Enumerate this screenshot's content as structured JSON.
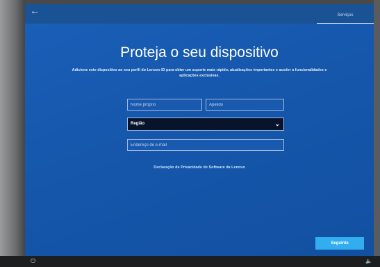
{
  "topbar": {
    "back_icon": "arrow-left-icon",
    "services_tab": "Serviços"
  },
  "main": {
    "title": "Proteja o seu dispositivo",
    "subtitle": "Adicione este dispositivo ao seu perfil do Lenovo ID para obter um suporte mais rápido, atualizações importantes e aceder a funcionalidades e aplicações exclusivas."
  },
  "form": {
    "first_name_placeholder": "Nome próprio",
    "last_name_placeholder": "Apelido",
    "region_label": "Região",
    "email_placeholder": "Endereço de e-mail"
  },
  "privacy_link": "Declaração de Privacidade de Software da Lenovo",
  "next_button": "Seguinte",
  "taskbar": {
    "power_icon": "power-icon",
    "volume_icon": "volume-icon"
  },
  "colors": {
    "screen_blue": "#1658ad",
    "next_button": "#32aef0",
    "region_select": "#08142c",
    "link": "#bfe2ff"
  }
}
